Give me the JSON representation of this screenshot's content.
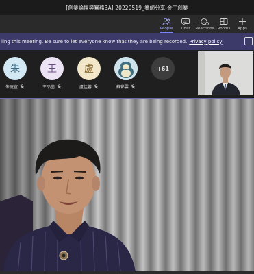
{
  "window": {
    "title": "[創業論壇與實務3A] 20220519_業師分享-金工創業"
  },
  "toolbar": {
    "people_label": "People",
    "chat_label": "Chat",
    "reactions_label": "Reactions",
    "rooms_label": "Rooms",
    "apps_label": "Apps",
    "active_tab": "People"
  },
  "banner": {
    "message": "ling this meeting. Be sure to let everyone know that they are being recorded.",
    "link_text": "Privacy policy"
  },
  "participants": [
    {
      "initial": "朱",
      "name": "朱庭宣",
      "avatar_bg": "#d2e8f3",
      "avatar_fg": "#3a6b86",
      "muted": true
    },
    {
      "initial": "王",
      "name": "王品茵",
      "avatar_bg": "#ece3f4",
      "avatar_fg": "#6a4e86",
      "muted": true
    },
    {
      "initial": "盧",
      "name": "盧佳蓉",
      "avatar_bg": "#f3e7c9",
      "avatar_fg": "#7a5b20",
      "muted": true
    },
    {
      "initial": "",
      "name": "蘇彩雲",
      "avatar_bg": "#cfe3ec",
      "avatar_fg": "#333333",
      "muted": true
    }
  ],
  "more_participants": "+61",
  "colors": {
    "accent": "#7f85f5",
    "banner_bg": "#3b3a69",
    "toolbar_bg": "#2a2a2a"
  }
}
